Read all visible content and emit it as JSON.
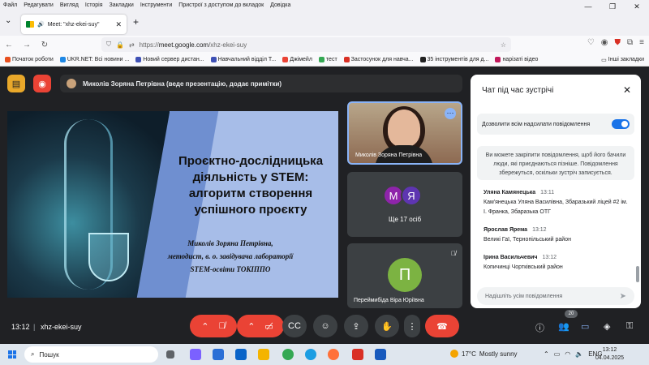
{
  "menu": [
    "Файл",
    "Редагувати",
    "Вигляд",
    "Історія",
    "Закладки",
    "Інструменти",
    "Пристрої з доступом до вкладок",
    "Довідка"
  ],
  "window_controls": {
    "minimize": "—",
    "restore": "❐",
    "close": "✕"
  },
  "tab": {
    "title": "Meet: \"xhz-ekei-suy\"",
    "audio_icon": "🔊",
    "close": "✕"
  },
  "new_tab": "+",
  "url": {
    "scheme": "https://",
    "domain": "meet.google.com",
    "path": "/xhz-ekei-suy"
  },
  "bookmarks": [
    "Початок роботи",
    "UKR.NET: Всі новини ...",
    "Новий сервер дистан...",
    "Навчальний відділ Т...",
    "Джімейл",
    "тест",
    "Застосунок для навча...",
    "35 інструментів для д...",
    "нарізаті відео"
  ],
  "bookmarks_other": "Інші закладки",
  "presenter_bar": "Миколів Зоряна Петрівна (веде презентацію, додає примітки)",
  "slide": {
    "title": "Проєктно-дослідницька діяльність у STEM: алгоритм створення успішного проєкту",
    "subtitle_lines": [
      "Миколів Зоряна Петрівна,",
      "методист, в. о. завідувача  лабораторії",
      "STEM-освіти ТОКІППО"
    ]
  },
  "tiles": {
    "main_name": "Миколів Зоряна Петрівна",
    "avatars": [
      {
        "letter": "М",
        "color": "#8e24aa"
      },
      {
        "letter": "Я",
        "color": "#5e35b1"
      }
    ],
    "others_label": "Ще 17 осіб",
    "third_letter": "П",
    "third_name": "Переймибіда Віра Юріївна"
  },
  "chat": {
    "title": "Чат під час зустрічі",
    "permission": "Дозволити всім надсилати повідомлення",
    "note": "Ви можете закріпити повідомлення, щоб його бачили люди, які приєднаються пізніше. Повідомлення збережуться, оскільки зустріч записується.",
    "messages": [
      {
        "author": "Уляна Камянецька",
        "time": "13:11",
        "text": "Кам'янецька Уляна Василівна, Збаразький ліцей #2 ім. І. Франка, Збаразька ОТГ"
      },
      {
        "author": "Ярослав Ярема",
        "time": "13:12",
        "text": "Великі Гаї, Тернопільський район"
      },
      {
        "author": "Ірина Васильчевич",
        "time": "13:12",
        "text": "Копичинці Чортківський район"
      }
    ],
    "input_placeholder": "Надішліть усім повідомлення"
  },
  "controls": {
    "time": "13:12",
    "separator": "|",
    "meeting_code": "xhz-ekei-suy",
    "participants_count": "20"
  },
  "taskbar": {
    "search": "Пошук",
    "weather_temp": "17°C",
    "weather_text": "Mostly sunny",
    "lang": "ENG",
    "time": "13:12",
    "date": "04.04.2025"
  }
}
